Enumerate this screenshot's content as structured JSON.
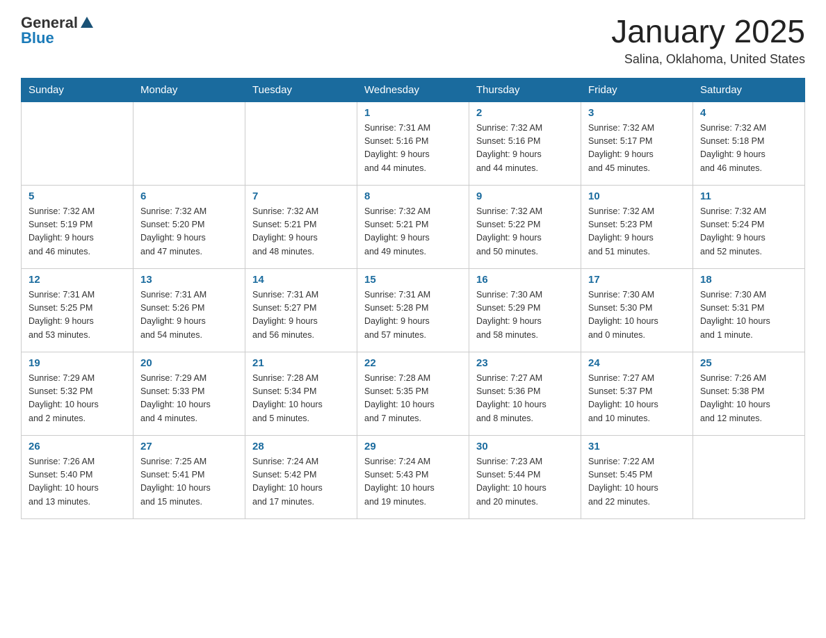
{
  "header": {
    "logo_general": "General",
    "logo_blue": "Blue",
    "month_title": "January 2025",
    "location": "Salina, Oklahoma, United States"
  },
  "weekdays": [
    "Sunday",
    "Monday",
    "Tuesday",
    "Wednesday",
    "Thursday",
    "Friday",
    "Saturday"
  ],
  "weeks": [
    [
      {
        "day": "",
        "info": ""
      },
      {
        "day": "",
        "info": ""
      },
      {
        "day": "",
        "info": ""
      },
      {
        "day": "1",
        "info": "Sunrise: 7:31 AM\nSunset: 5:16 PM\nDaylight: 9 hours\nand 44 minutes."
      },
      {
        "day": "2",
        "info": "Sunrise: 7:32 AM\nSunset: 5:16 PM\nDaylight: 9 hours\nand 44 minutes."
      },
      {
        "day": "3",
        "info": "Sunrise: 7:32 AM\nSunset: 5:17 PM\nDaylight: 9 hours\nand 45 minutes."
      },
      {
        "day": "4",
        "info": "Sunrise: 7:32 AM\nSunset: 5:18 PM\nDaylight: 9 hours\nand 46 minutes."
      }
    ],
    [
      {
        "day": "5",
        "info": "Sunrise: 7:32 AM\nSunset: 5:19 PM\nDaylight: 9 hours\nand 46 minutes."
      },
      {
        "day": "6",
        "info": "Sunrise: 7:32 AM\nSunset: 5:20 PM\nDaylight: 9 hours\nand 47 minutes."
      },
      {
        "day": "7",
        "info": "Sunrise: 7:32 AM\nSunset: 5:21 PM\nDaylight: 9 hours\nand 48 minutes."
      },
      {
        "day": "8",
        "info": "Sunrise: 7:32 AM\nSunset: 5:21 PM\nDaylight: 9 hours\nand 49 minutes."
      },
      {
        "day": "9",
        "info": "Sunrise: 7:32 AM\nSunset: 5:22 PM\nDaylight: 9 hours\nand 50 minutes."
      },
      {
        "day": "10",
        "info": "Sunrise: 7:32 AM\nSunset: 5:23 PM\nDaylight: 9 hours\nand 51 minutes."
      },
      {
        "day": "11",
        "info": "Sunrise: 7:32 AM\nSunset: 5:24 PM\nDaylight: 9 hours\nand 52 minutes."
      }
    ],
    [
      {
        "day": "12",
        "info": "Sunrise: 7:31 AM\nSunset: 5:25 PM\nDaylight: 9 hours\nand 53 minutes."
      },
      {
        "day": "13",
        "info": "Sunrise: 7:31 AM\nSunset: 5:26 PM\nDaylight: 9 hours\nand 54 minutes."
      },
      {
        "day": "14",
        "info": "Sunrise: 7:31 AM\nSunset: 5:27 PM\nDaylight: 9 hours\nand 56 minutes."
      },
      {
        "day": "15",
        "info": "Sunrise: 7:31 AM\nSunset: 5:28 PM\nDaylight: 9 hours\nand 57 minutes."
      },
      {
        "day": "16",
        "info": "Sunrise: 7:30 AM\nSunset: 5:29 PM\nDaylight: 9 hours\nand 58 minutes."
      },
      {
        "day": "17",
        "info": "Sunrise: 7:30 AM\nSunset: 5:30 PM\nDaylight: 10 hours\nand 0 minutes."
      },
      {
        "day": "18",
        "info": "Sunrise: 7:30 AM\nSunset: 5:31 PM\nDaylight: 10 hours\nand 1 minute."
      }
    ],
    [
      {
        "day": "19",
        "info": "Sunrise: 7:29 AM\nSunset: 5:32 PM\nDaylight: 10 hours\nand 2 minutes."
      },
      {
        "day": "20",
        "info": "Sunrise: 7:29 AM\nSunset: 5:33 PM\nDaylight: 10 hours\nand 4 minutes."
      },
      {
        "day": "21",
        "info": "Sunrise: 7:28 AM\nSunset: 5:34 PM\nDaylight: 10 hours\nand 5 minutes."
      },
      {
        "day": "22",
        "info": "Sunrise: 7:28 AM\nSunset: 5:35 PM\nDaylight: 10 hours\nand 7 minutes."
      },
      {
        "day": "23",
        "info": "Sunrise: 7:27 AM\nSunset: 5:36 PM\nDaylight: 10 hours\nand 8 minutes."
      },
      {
        "day": "24",
        "info": "Sunrise: 7:27 AM\nSunset: 5:37 PM\nDaylight: 10 hours\nand 10 minutes."
      },
      {
        "day": "25",
        "info": "Sunrise: 7:26 AM\nSunset: 5:38 PM\nDaylight: 10 hours\nand 12 minutes."
      }
    ],
    [
      {
        "day": "26",
        "info": "Sunrise: 7:26 AM\nSunset: 5:40 PM\nDaylight: 10 hours\nand 13 minutes."
      },
      {
        "day": "27",
        "info": "Sunrise: 7:25 AM\nSunset: 5:41 PM\nDaylight: 10 hours\nand 15 minutes."
      },
      {
        "day": "28",
        "info": "Sunrise: 7:24 AM\nSunset: 5:42 PM\nDaylight: 10 hours\nand 17 minutes."
      },
      {
        "day": "29",
        "info": "Sunrise: 7:24 AM\nSunset: 5:43 PM\nDaylight: 10 hours\nand 19 minutes."
      },
      {
        "day": "30",
        "info": "Sunrise: 7:23 AM\nSunset: 5:44 PM\nDaylight: 10 hours\nand 20 minutes."
      },
      {
        "day": "31",
        "info": "Sunrise: 7:22 AM\nSunset: 5:45 PM\nDaylight: 10 hours\nand 22 minutes."
      },
      {
        "day": "",
        "info": ""
      }
    ]
  ]
}
